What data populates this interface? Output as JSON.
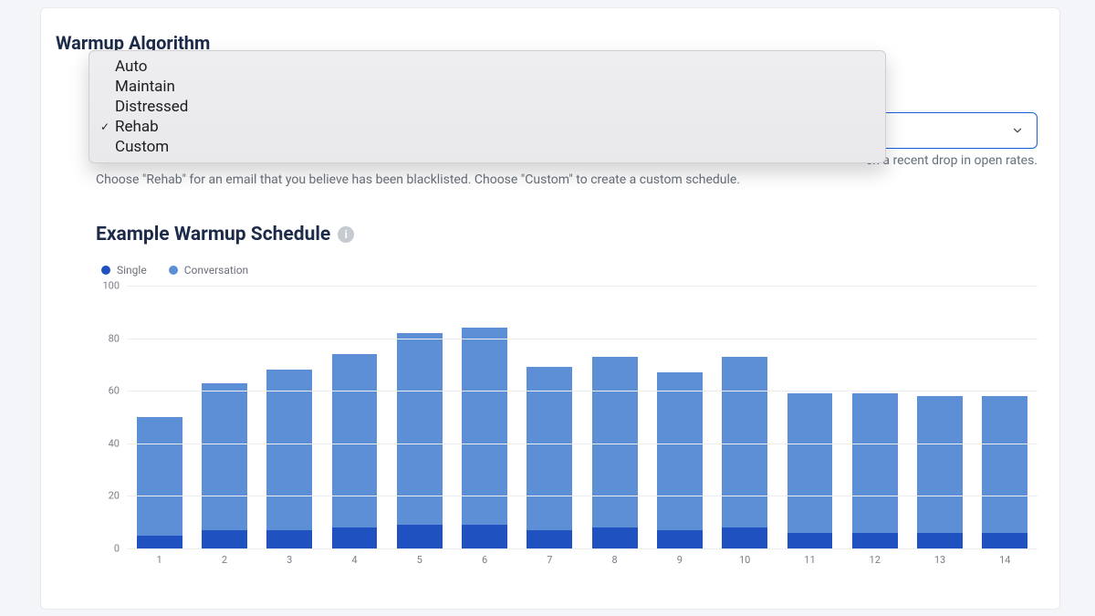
{
  "section_title": "Warmup Algorithm",
  "dropdown": {
    "options": [
      "Auto",
      "Maintain",
      "Distressed",
      "Rehab",
      "Custom"
    ],
    "selected": "Rehab"
  },
  "help_line1_tail": "en a recent drop in open rates.",
  "help_line2": "Choose \"Rehab\" for an email that you believe has been blacklisted. Choose \"Custom\" to create a custom schedule.",
  "chart": {
    "title": "Example Warmup Schedule",
    "legend": {
      "single": "Single",
      "conversation": "Conversation"
    }
  },
  "chart_data": {
    "type": "bar-stacked",
    "title": "Example Warmup Schedule",
    "xlabel": "",
    "ylabel": "",
    "ylim": [
      0,
      100
    ],
    "yticks": [
      0,
      20,
      40,
      60,
      80,
      100
    ],
    "categories": [
      "1",
      "2",
      "3",
      "4",
      "5",
      "6",
      "7",
      "8",
      "9",
      "10",
      "11",
      "12",
      "13",
      "14"
    ],
    "series": [
      {
        "name": "Single",
        "color": "#1f52c0",
        "values": [
          5,
          7,
          7,
          8,
          9,
          9,
          7,
          8,
          7,
          8,
          6,
          6,
          6,
          6
        ]
      },
      {
        "name": "Conversation",
        "color": "#5c8fd6",
        "values": [
          45,
          56,
          61,
          66,
          73,
          75,
          62,
          65,
          60,
          65,
          53,
          53,
          52,
          52
        ]
      }
    ],
    "totals": [
      50,
      63,
      68,
      74,
      82,
      84,
      69,
      73,
      67,
      73,
      59,
      59,
      58,
      58
    ]
  }
}
